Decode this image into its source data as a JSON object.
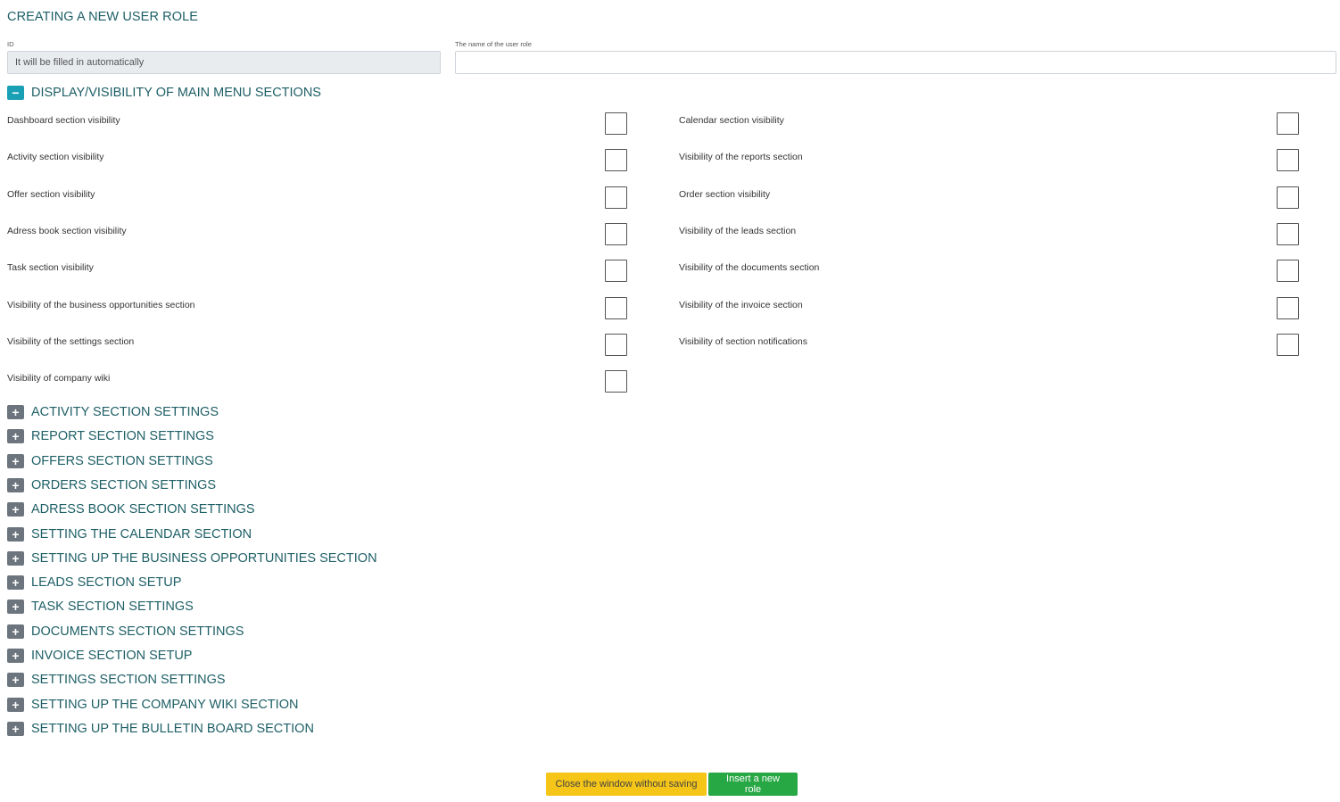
{
  "page": {
    "title": "CREATING A NEW USER ROLE"
  },
  "form": {
    "id_label": "ID",
    "id_value": "It will be filled in automatically",
    "name_label": "The name of the user role",
    "name_value": ""
  },
  "main_section": {
    "title": "DISPLAY/VISIBILITY OF MAIN MENU SECTIONS",
    "toggle_symbol": "−",
    "left_items": [
      "Dashboard section visibility",
      "Activity section visibility",
      "Offer section visibility",
      "Adress book section visibility",
      "Task section visibility",
      "Visibility of the business opportunities section",
      "Visibility of the settings section",
      "Visibility of company wiki"
    ],
    "right_items": [
      "Calendar section visibility",
      "Visibility of the reports section",
      "Order section visibility",
      "Visibility of the leads section",
      "Visibility of the documents section",
      "Visibility of the invoice section",
      "Visibility of section notifications"
    ]
  },
  "collapsed_sections": {
    "toggle_symbol": "+",
    "items": [
      "ACTIVITY SECTION SETTINGS",
      "REPORT SECTION SETTINGS",
      "OFFERS SECTION SETTINGS",
      "ORDERS SECTION SETTINGS",
      "ADRESS BOOK SECTION SETTINGS",
      "SETTING THE CALENDAR SECTION",
      "SETTING UP THE BUSINESS OPPORTUNITIES SECTION",
      "LEADS SECTION SETUP",
      "TASK SECTION SETTINGS",
      "DOCUMENTS SECTION SETTINGS",
      "INVOICE SECTION SETUP",
      "SETTINGS SECTION SETTINGS",
      "SETTING UP THE COMPANY WIKI SECTION",
      "SETTING UP THE BULLETIN BOARD SECTION"
    ]
  },
  "buttons": {
    "close_label": "Close the window without saving",
    "insert_label": "Insert a new role"
  },
  "colors": {
    "accent": "#1aa0b5",
    "heading": "#1e5f66",
    "close_button": "#f5c518",
    "insert_button": "#28a745"
  }
}
